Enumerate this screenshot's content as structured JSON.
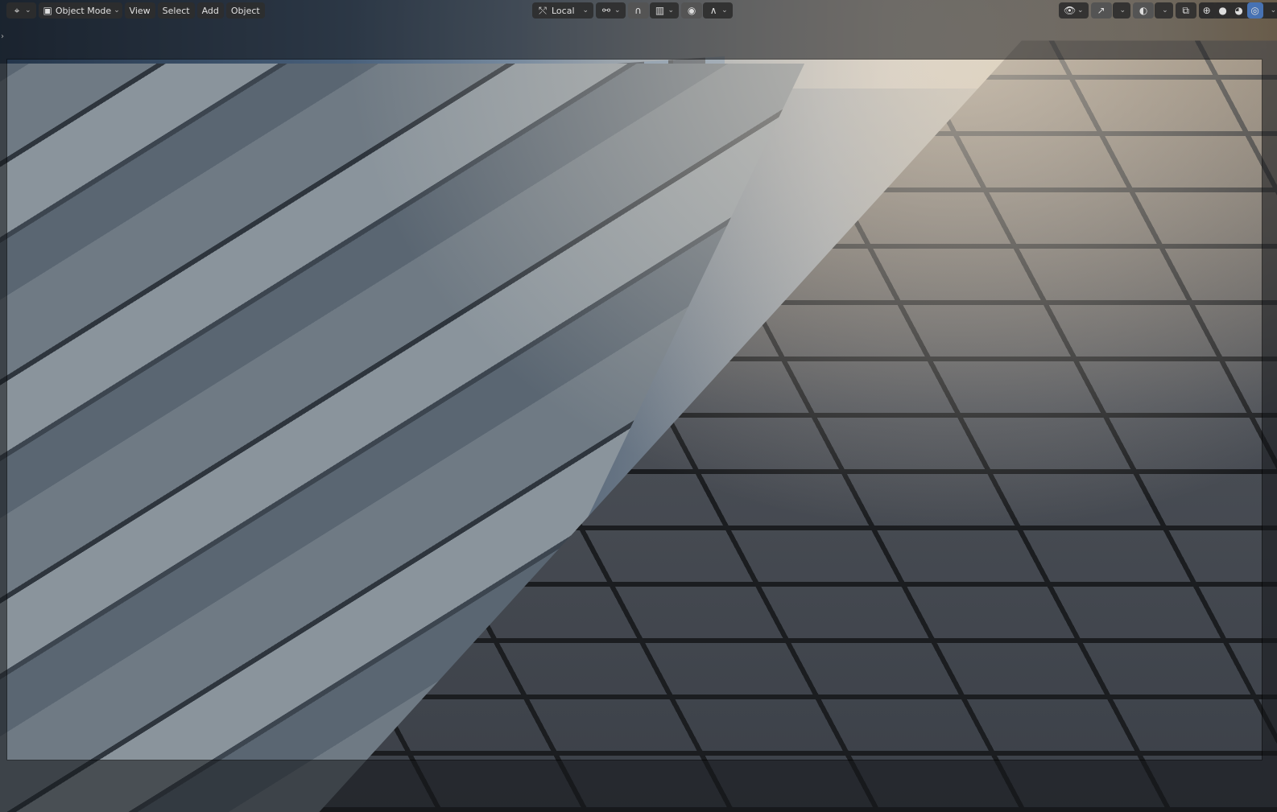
{
  "header": {
    "editor_type_icon": "3d-viewport-icon",
    "mode": "Object Mode",
    "menus": [
      "View",
      "Select",
      "Add",
      "Object"
    ],
    "transform_orientation": "Local",
    "pivot_icon": "pivot-icon",
    "snap_icon": "snap-magnet-icon",
    "snap_target_icon": "snap-increment-icon",
    "proportional_icon": "proportional-editing-icon",
    "falloff_icon": "falloff-curve-icon",
    "shading_modes": [
      "wireframe",
      "solid",
      "material-preview",
      "rendered"
    ],
    "active_shading": "rendered"
  },
  "colors": {
    "accent": "#4772b3",
    "header_bg": "#2d2d2d"
  }
}
